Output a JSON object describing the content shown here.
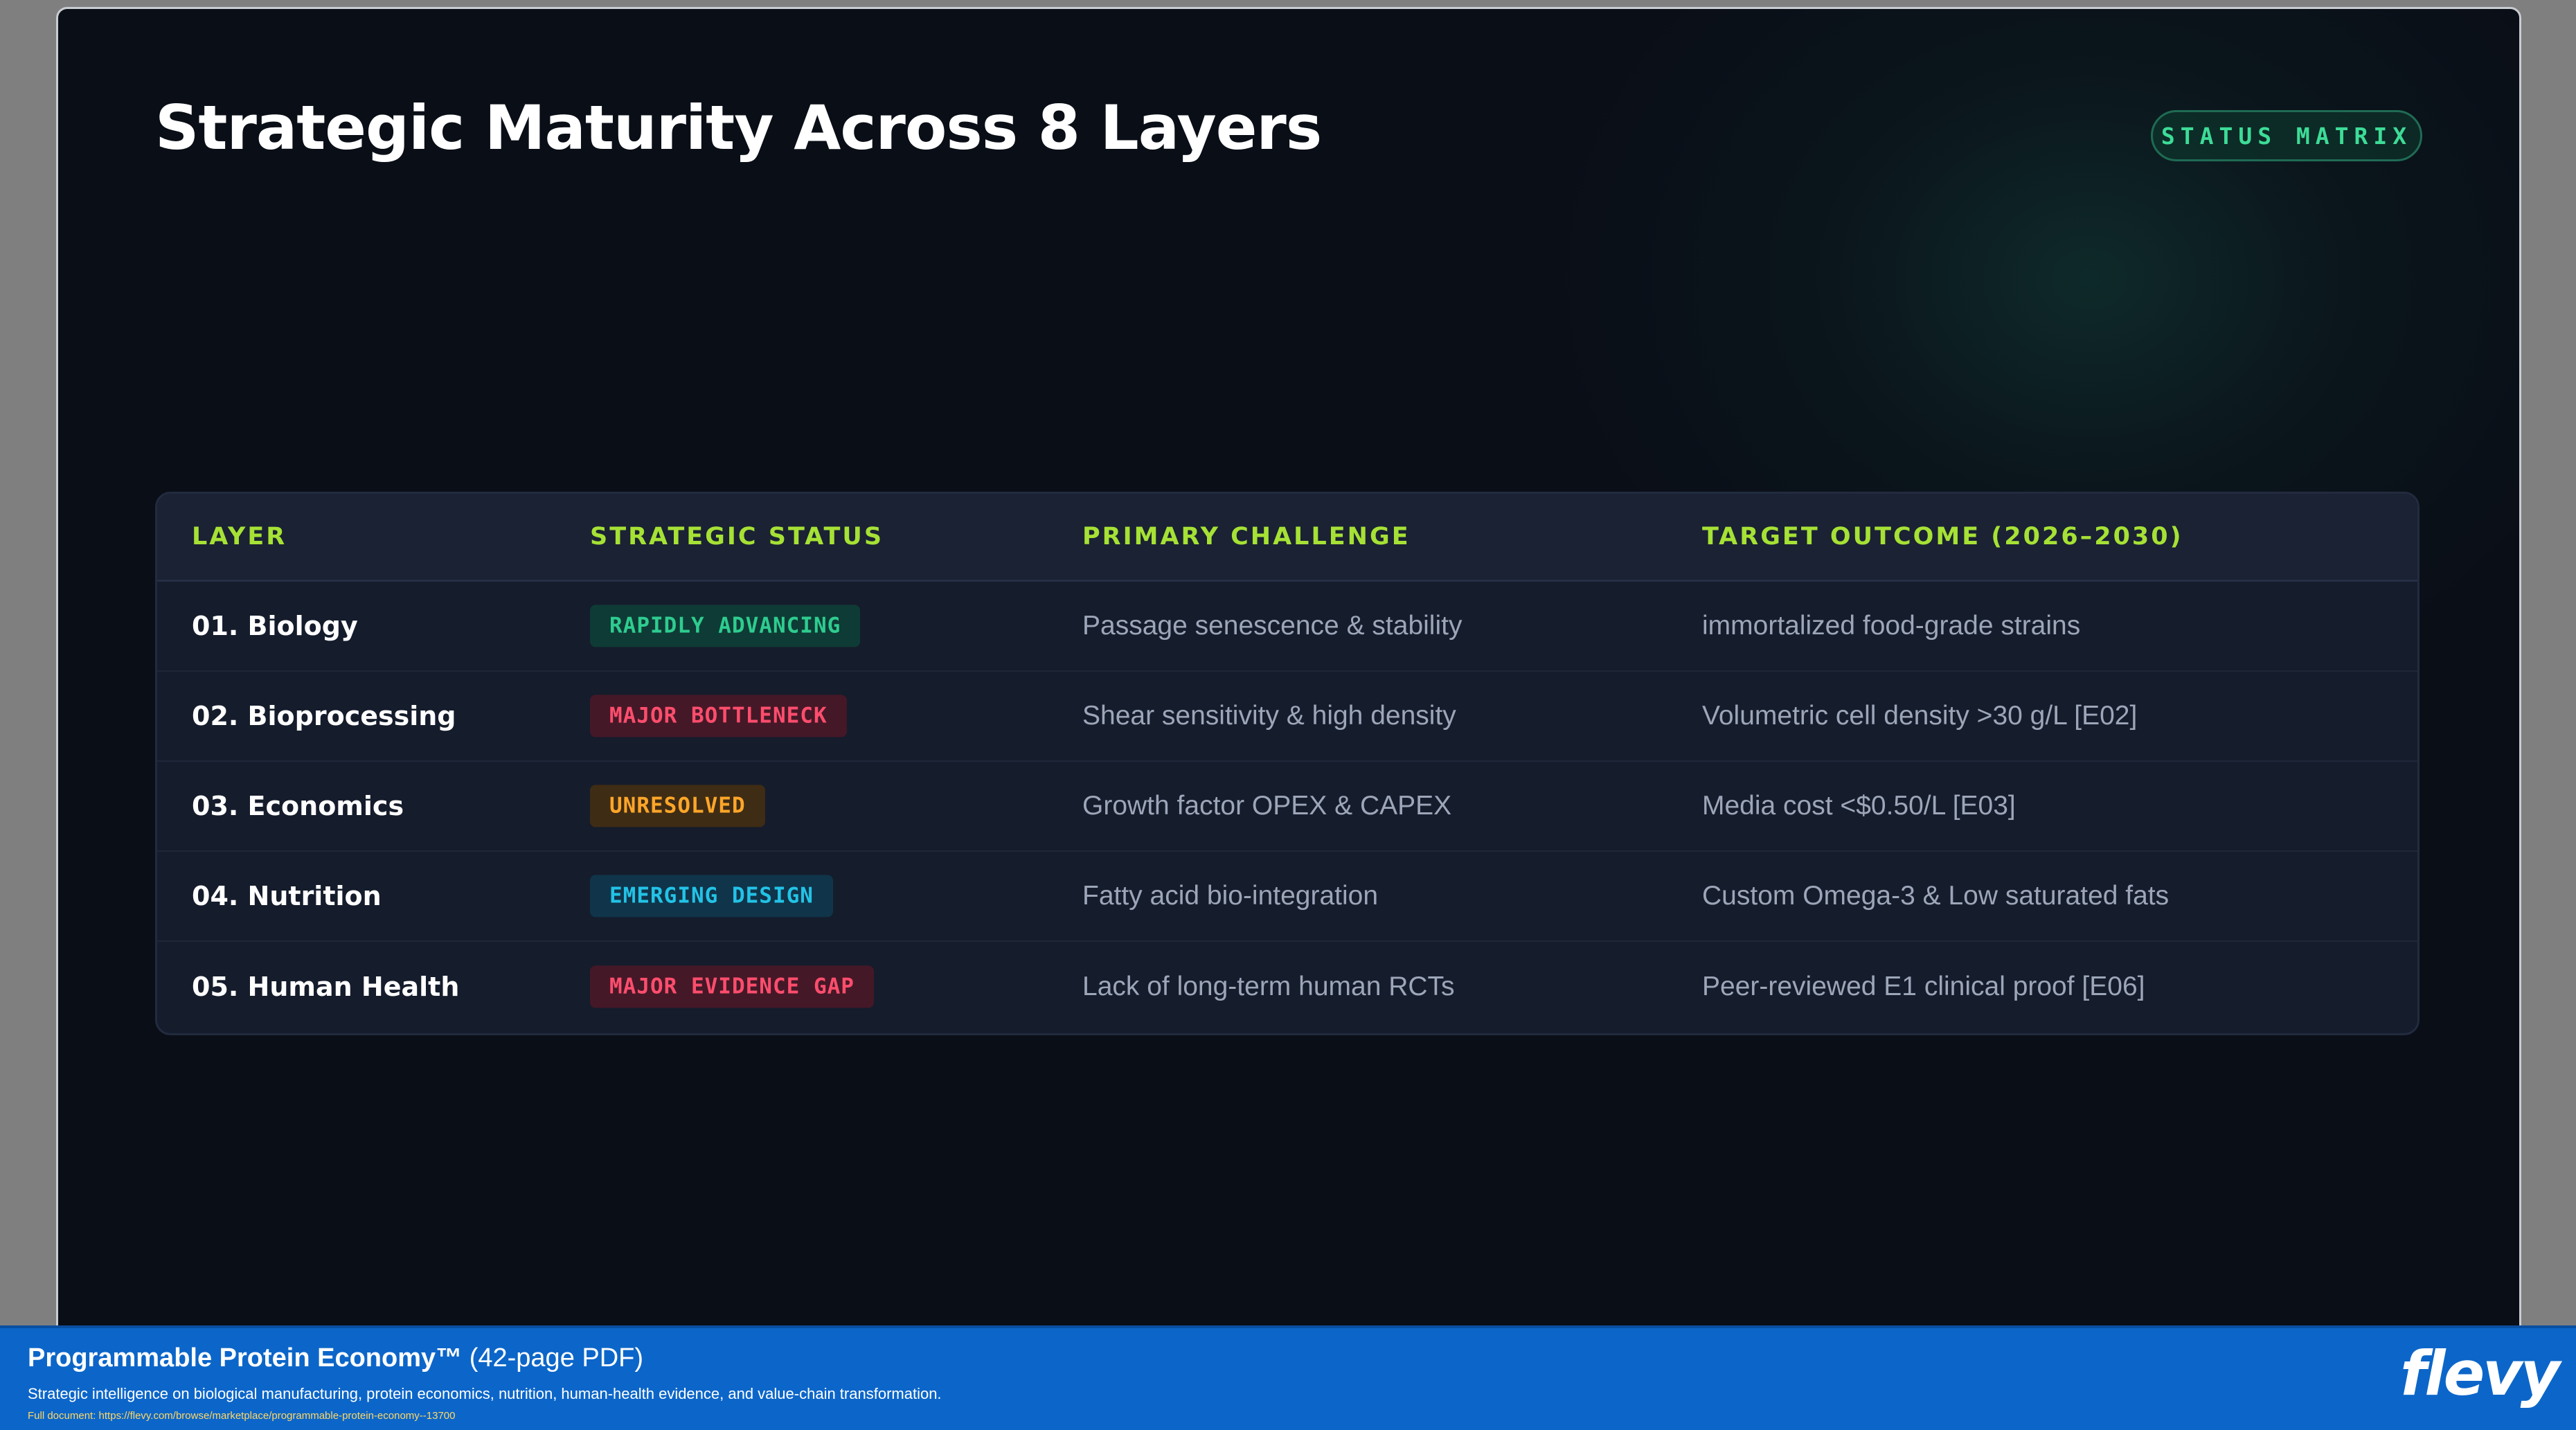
{
  "slide": {
    "title": "Strategic Maturity Across 8 Layers",
    "status_pill": "STATUS MATRIX"
  },
  "table": {
    "headers": [
      "LAYER",
      "STRATEGIC STATUS",
      "PRIMARY CHALLENGE",
      "TARGET OUTCOME (2026–2030)"
    ],
    "rows": [
      {
        "layer": "01. Biology",
        "status": "RAPIDLY ADVANCING",
        "challenge": "Passage senescence & stability",
        "outcome": "immortalized food-grade strains"
      },
      {
        "layer": "02. Bioprocessing",
        "status": "MAJOR BOTTLENECK",
        "challenge": "Shear sensitivity & high density",
        "outcome": "Volumetric cell density >30 g/L [E02]"
      },
      {
        "layer": "03. Economics",
        "status": "UNRESOLVED",
        "challenge": "Growth factor OPEX & CAPEX",
        "outcome": "Media cost <$0.50/L [E03]"
      },
      {
        "layer": "04. Nutrition",
        "status": "EMERGING DESIGN",
        "challenge": "Fatty acid bio-integration",
        "outcome": "Custom Omega-3 & Low saturated fats"
      },
      {
        "layer": "05. Human Health",
        "status": "MAJOR EVIDENCE GAP",
        "challenge": "Lack of long-term human RCTs",
        "outcome": "Peer-reviewed E1 clinical proof [E06]"
      }
    ]
  },
  "footer": {
    "title_strong": "Programmable Protein Economy™",
    "title_suffix": " (42-page PDF)",
    "description": "Strategic intelligence on biological manufacturing, protein economics, nutrition, human-health evidence, and value-chain transformation.",
    "link": "Full document: https://flevy.com/browse/marketplace/programmable-protein-economy--13700",
    "logo": "flevy"
  },
  "colors": {
    "slide_bg": "#0a0e17",
    "header_accent": "#a6e135",
    "pill_text": "#3ddc97",
    "badge_advancing": "#2ecc8f",
    "badge_bottleneck": "#ff4d6d",
    "badge_unresolved": "#ffa629",
    "badge_emerging": "#22c3e6",
    "footer_bg": "#0c66c9"
  }
}
